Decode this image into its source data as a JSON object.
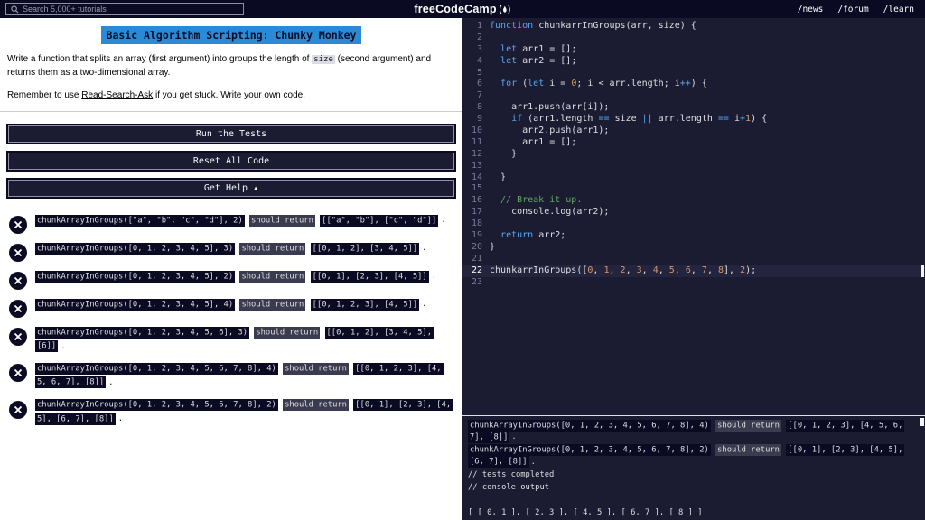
{
  "colors": {
    "navy": "#0a0a23",
    "editor_bg": "#1b1b32",
    "title_highlight": "#2b8ad6",
    "keyword_blue": "#57a9f0",
    "number_orange": "#d19a66",
    "comment_green": "#62a862"
  },
  "topbar": {
    "search_placeholder": "Search 5,000+ tutorials",
    "logo_text": "freeCodeCamp",
    "links": [
      "/news",
      "/forum",
      "/learn"
    ]
  },
  "panel": {
    "title": "Basic Algorithm Scripting: Chunky Monkey",
    "description": {
      "pre": "Write a function that splits an array (first argument) into groups the length of ",
      "code": "size",
      "post": " (second argument) and returns them as a two-dimensional array."
    },
    "hint": {
      "pre": "Remember to use ",
      "link": "Read-Search-Ask",
      "post": " if you get stuck. Write your own code."
    },
    "buttons": {
      "run": "Run the Tests",
      "reset": "Reset All Code",
      "help": "Get Help ▴"
    }
  },
  "tests": {
    "middle": "should return",
    "terminator": ".",
    "items": [
      {
        "call": "chunkArrayInGroups([\"a\", \"b\", \"c\", \"d\"], 2)",
        "expected": "[[\"a\", \"b\"], [\"c\", \"d\"]]"
      },
      {
        "call": "chunkArrayInGroups([0, 1, 2, 3, 4, 5], 3)",
        "expected": "[[0, 1, 2], [3, 4, 5]]"
      },
      {
        "call": "chunkArrayInGroups([0, 1, 2, 3, 4, 5], 2)",
        "expected": "[[0, 1], [2, 3], [4, 5]]"
      },
      {
        "call": "chunkArrayInGroups([0, 1, 2, 3, 4, 5], 4)",
        "expected": "[[0, 1, 2, 3], [4, 5]]"
      },
      {
        "call": "chunkArrayInGroups([0, 1, 2, 3, 4, 5, 6], 3)",
        "expected": "[[0, 1, 2], [3, 4, 5], [6]]"
      },
      {
        "call": "chunkArrayInGroups([0, 1, 2, 3, 4, 5, 6, 7, 8], 4)",
        "expected": "[[0, 1, 2, 3], [4, 5, 6, 7], [8]]"
      },
      {
        "call": "chunkArrayInGroups([0, 1, 2, 3, 4, 5, 6, 7, 8], 2)",
        "expected": "[[0, 1], [2, 3], [4, 5], [6, 7], [8]]"
      }
    ]
  },
  "editor": {
    "lines": [
      {
        "n": 1,
        "tokens": [
          [
            "kw",
            "function"
          ],
          [
            "txt",
            " chunkarrInGroups(arr, size) {"
          ]
        ]
      },
      {
        "n": 2,
        "tokens": []
      },
      {
        "n": 3,
        "tokens": [
          [
            "txt",
            "  "
          ],
          [
            "kw",
            "let"
          ],
          [
            "txt",
            " arr1 = [];"
          ]
        ]
      },
      {
        "n": 4,
        "tokens": [
          [
            "txt",
            "  "
          ],
          [
            "kw",
            "let"
          ],
          [
            "txt",
            " arr2 = [];"
          ]
        ]
      },
      {
        "n": 5,
        "tokens": []
      },
      {
        "n": 6,
        "tokens": [
          [
            "txt",
            "  "
          ],
          [
            "kw",
            "for"
          ],
          [
            "txt",
            " ("
          ],
          [
            "kw",
            "let"
          ],
          [
            "txt",
            " i = "
          ],
          [
            "num",
            "0"
          ],
          [
            "txt",
            "; i < arr.length; i"
          ],
          [
            "op",
            "++"
          ],
          [
            "txt",
            ") {"
          ]
        ]
      },
      {
        "n": 7,
        "tokens": []
      },
      {
        "n": 8,
        "tokens": [
          [
            "txt",
            "    arr1.push(arr[i]);"
          ]
        ]
      },
      {
        "n": 9,
        "tokens": [
          [
            "txt",
            "    "
          ],
          [
            "kw",
            "if"
          ],
          [
            "txt",
            " (arr1.length "
          ],
          [
            "op",
            "=="
          ],
          [
            "txt",
            " size "
          ],
          [
            "op",
            "||"
          ],
          [
            "txt",
            " arr.length "
          ],
          [
            "op",
            "=="
          ],
          [
            "txt",
            " i"
          ],
          [
            "op",
            "+"
          ],
          [
            "num",
            "1"
          ],
          [
            "txt",
            ") {"
          ]
        ]
      },
      {
        "n": 10,
        "tokens": [
          [
            "txt",
            "      arr2.push(arr1);"
          ]
        ]
      },
      {
        "n": 11,
        "tokens": [
          [
            "txt",
            "      arr1 = [];"
          ]
        ]
      },
      {
        "n": 12,
        "tokens": [
          [
            "txt",
            "    }"
          ]
        ]
      },
      {
        "n": 13,
        "tokens": []
      },
      {
        "n": 14,
        "tokens": [
          [
            "txt",
            "  }"
          ]
        ]
      },
      {
        "n": 15,
        "tokens": []
      },
      {
        "n": 16,
        "tokens": [
          [
            "com",
            "  // Break it up."
          ]
        ]
      },
      {
        "n": 17,
        "tokens": [
          [
            "txt",
            "    console.log(arr2);"
          ]
        ]
      },
      {
        "n": 18,
        "tokens": []
      },
      {
        "n": 19,
        "tokens": [
          [
            "txt",
            "  "
          ],
          [
            "kw",
            "return"
          ],
          [
            "txt",
            " arr2;"
          ]
        ]
      },
      {
        "n": 20,
        "tokens": [
          [
            "txt",
            "}"
          ]
        ]
      },
      {
        "n": 21,
        "tokens": []
      },
      {
        "n": 22,
        "active": true,
        "tokens": [
          [
            "txt",
            "chunkarrInGroups(["
          ],
          [
            "num",
            "0"
          ],
          [
            "txt",
            ", "
          ],
          [
            "num",
            "1"
          ],
          [
            "txt",
            ", "
          ],
          [
            "num",
            "2"
          ],
          [
            "txt",
            ", "
          ],
          [
            "num",
            "3"
          ],
          [
            "txt",
            ", "
          ],
          [
            "num",
            "4"
          ],
          [
            "txt",
            ", "
          ],
          [
            "num",
            "5"
          ],
          [
            "txt",
            ", "
          ],
          [
            "num",
            "6"
          ],
          [
            "txt",
            ", "
          ],
          [
            "num",
            "7"
          ],
          [
            "txt",
            ", "
          ],
          [
            "num",
            "8"
          ],
          [
            "txt",
            "], "
          ],
          [
            "num",
            "2"
          ],
          [
            "txt",
            ");"
          ]
        ]
      },
      {
        "n": 23,
        "tokens": []
      }
    ]
  },
  "console_panel": {
    "entries": [
      {
        "type": "test",
        "call": "chunkArrayInGroups([0, 1, 2, 3, 4, 5, 6, 7, 8], 4)",
        "middle": "should return",
        "expected": "[[0, 1, 2, 3], [4, 5, 6, 7], [8]]",
        "terminator": "."
      },
      {
        "type": "test",
        "call": "chunkArrayInGroups([0, 1, 2, 3, 4, 5, 6, 7, 8], 2)",
        "middle": "should return",
        "expected": "[[0, 1], [2, 3], [4, 5], [6, 7], [8]]",
        "terminator": "."
      },
      {
        "type": "plain",
        "text": "// tests completed"
      },
      {
        "type": "plain",
        "text": "// console output"
      },
      {
        "type": "plain",
        "text": ""
      },
      {
        "type": "plain",
        "text": "[ [ 0, 1 ], [ 2, 3 ], [ 4, 5 ], [ 6, 7 ], [ 8 ] ]"
      }
    ]
  }
}
